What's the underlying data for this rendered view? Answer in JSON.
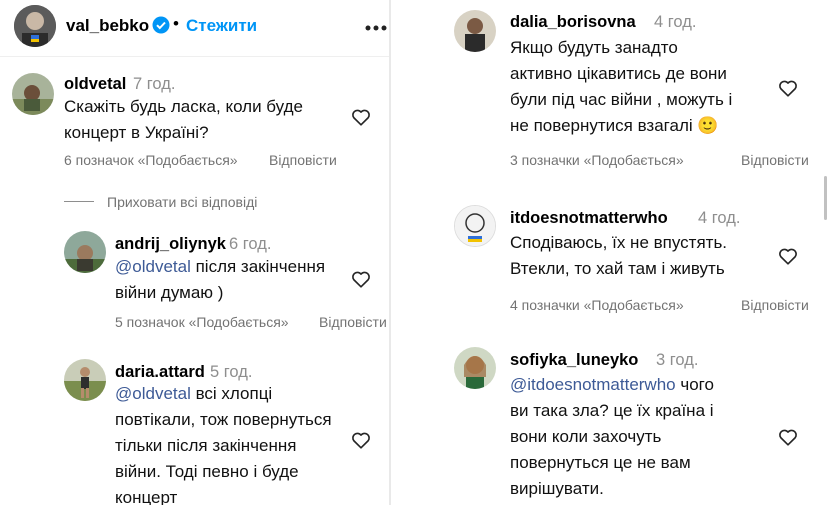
{
  "header": {
    "username": "val_bebko",
    "follow_label": "Стежити",
    "more_icon": "ellipsis-icon",
    "verified_color": "#0095f6"
  },
  "left": {
    "c1": {
      "user": "oldvetal",
      "time": "7 год.",
      "text": "Скажіть будь ласка, коли буде\nконцерт в Україні?",
      "likes": "6 позначок «Подобається»",
      "reply": "Відповісти"
    },
    "hide_replies": "Приховати всі відповіді",
    "r1": {
      "user": "andrij_oliynyk",
      "time": "6 год.",
      "mention": "@oldvetal",
      "text": " після закінчення\nвійни думаю )",
      "likes": "5 позначок «Подобається»",
      "reply": "Відповісти"
    },
    "r2": {
      "user": "daria.attard",
      "time": "5 год.",
      "mention": "@oldvetal",
      "text": " всі хлопці\nповтікали, тож повернуться\nтільки після закінчення\nвійни. Тоді певно і буде\nконцерт"
    }
  },
  "right": {
    "c1": {
      "user": "dalia_borisovna",
      "time": "4 год.",
      "text": "Якщо будуть занадто\nактивно цікавитись де вони\nбули під час війни , можуть і\nне повернутися взагалі 🙂",
      "likes": "3 позначки «Подобається»",
      "reply": "Відповісти"
    },
    "c2": {
      "user": "itdoesnotmatterwho",
      "time": "4 год.",
      "text": "Сподіваюсь, їх не впустять.\nВтекли, то хай там і живуть",
      "likes": "4 позначки «Подобається»",
      "reply": "Відповісти"
    },
    "c3": {
      "user": "sofiyka_luneyko",
      "time": "3 год.",
      "mention": "@itdoesnotmatterwho",
      "text": "\nви така зла? це їх країна і\nвони коли захочуть\nповернуться це не вам\nвирішувати.",
      "mention_tail": " чого"
    }
  },
  "colors": {
    "accent": "#0095f6",
    "mention": "#3d5a96",
    "muted": "#737373",
    "divider": "#e9e9e9"
  }
}
